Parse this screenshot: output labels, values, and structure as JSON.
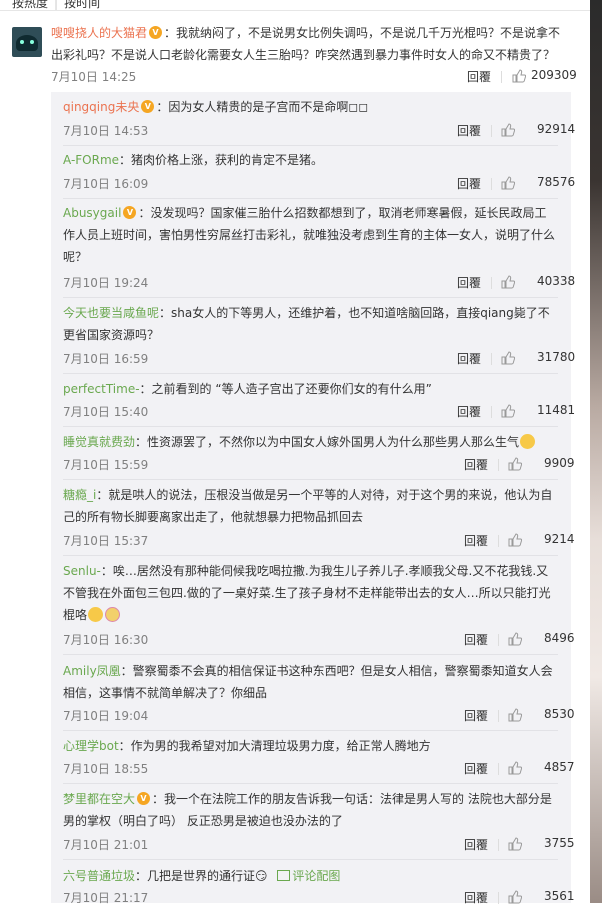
{
  "sort_tabs": {
    "hot": "按热度",
    "time": "按时间"
  },
  "main_comment": {
    "username": "嗖嗖挠人的大猫君",
    "text": "：我就纳闷了，不是说男女比例失调吗，不是说几千万光棍吗？不是说拿不出彩礼吗？不是说人口老龄化需要女人生三胎吗？咋突然遇到暴力事件时女人的命又不精贵了？",
    "time": "7月10日 14:25",
    "reply_label": "回覆",
    "likes": "209309"
  },
  "replies": [
    {
      "username": "qingqing未央",
      "text": "：因为女人精贵的是子宫而不是命啊◻◻",
      "time": "7月10日 14:53",
      "reply_label": "回覆",
      "likes": "92914"
    },
    {
      "username": "A-FORme",
      "text": "：猪肉价格上涨，获利的肯定不是猪。",
      "time": "7月10日 16:09",
      "reply_label": "回覆",
      "likes": "78576"
    },
    {
      "username": "Abusygail",
      "text": "：没发现吗？国家催三胎什么招数都想到了，取消老师寒暑假，延长民政局工作人员上班时间，害怕男性穷屌丝打击彩礼，就唯独没考虑到生育的主体一女人，说明了什么呢？",
      "time": "7月10日 19:24",
      "reply_label": "回覆",
      "likes": "40338"
    },
    {
      "username": "今天也要当咸鱼呢",
      "text": "：sha女人的下等男人，还维护着，也不知道啥脑回路，直接qiang毙了不更省国家资源吗？",
      "time": "7月10日 16:59",
      "reply_label": "回覆",
      "likes": "31780"
    },
    {
      "username": "perfectTime-",
      "text": "：之前看到的 “等人造子宫出了还要你们女的有什么用”",
      "time": "7月10日 15:40",
      "reply_label": "回覆",
      "likes": "11481"
    },
    {
      "username": "睡觉真就费劲",
      "text": "：性资源罢了，不然你以为中国女人嫁外国男人为什么那些男人那么生气",
      "time": "7月10日 15:59",
      "reply_label": "回覆",
      "likes": "9909"
    },
    {
      "username": "糖瘾_i",
      "text": "：就是哄人的说法，压根没当做是另一个平等的人对待，对于这个男的来说，他认为自己的所有物长脚要离家出走了，他就想暴力把物品抓回去",
      "time": "7月10日 15:37",
      "reply_label": "回覆",
      "likes": "9214"
    },
    {
      "username": "Senlu-",
      "text": "：唉…居然没有那种能伺候我吃喝拉撒.为我生儿子养儿子.孝顺我父母.又不花我钱.又不管我在外面包三包四.做的了一桌好菜.生了孩子身材不走样能带出去的女人…所以只能打光棍咯",
      "time": "7月10日 16:30",
      "reply_label": "回覆",
      "likes": "8496"
    },
    {
      "username": "Amily凤凰",
      "text": "：警察蜀黍不会真的相信保证书这种东西吧？但是女人相信，警察蜀黍知道女人会相信，这事情不就简单解决了？你细品",
      "time": "7月10日 19:04",
      "reply_label": "回覆",
      "likes": "8530"
    },
    {
      "username": "心理学bot",
      "text": "：作为男的我希望对加大清理垃圾男力度，给正常人腾地方",
      "time": "7月10日 18:55",
      "reply_label": "回覆",
      "likes": "4857"
    },
    {
      "username": "梦里都在空大",
      "text": "：我一个在法院工作的朋友告诉我一句话：法律是男人写的 法院也大部分是男的掌权（明白了吗） 反正恐男是被迫也没办法的了",
      "time": "7月10日 21:01",
      "reply_label": "回覆",
      "likes": "3755"
    },
    {
      "username": "六号普通垃圾",
      "text": "：几把是世界的通行证😏",
      "pic_link": "评论配图",
      "time": "7月10日 21:17",
      "reply_label": "回覆",
      "likes": "3561"
    }
  ],
  "colors": {
    "username": "#eb7350",
    "username_green": "#6aa84f",
    "reply_bg": "#f2f2f5",
    "meta": "#808080"
  },
  "icons": {
    "like": "thumbs-up-icon",
    "badge": "verified-badge-icon",
    "pic": "image-icon"
  }
}
